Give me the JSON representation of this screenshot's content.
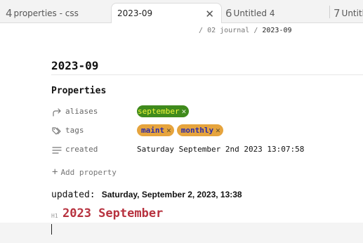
{
  "tabs": [
    {
      "num": "4",
      "label": "properties - css"
    },
    {
      "num": "",
      "label": "2023-09",
      "close": "✕"
    },
    {
      "num": "6",
      "label": "Untitled 4"
    },
    {
      "num": "7",
      "label": "Untitled"
    }
  ],
  "breadcrumb": {
    "sep1": "/",
    "folder": "02 journal",
    "sep2": "/",
    "current": "2023-09"
  },
  "note": {
    "title": "2023-09",
    "properties_heading": "Properties",
    "properties": [
      {
        "key": "aliases",
        "icon": "arrow-forward-icon",
        "values": [
          "september"
        ]
      },
      {
        "key": "tags",
        "icon": "tags-icon",
        "values": [
          "maint",
          "monthly"
        ]
      },
      {
        "key": "created",
        "icon": "text-lines-icon",
        "value": "Saturday September 2nd 2023 13:07:58"
      }
    ],
    "add_property": "Add property",
    "add_property_icon": "+",
    "updated_key": "updated:",
    "updated_value": "Saturday, September 2, 2023, 13:38",
    "h1_marker": "H1",
    "h1_text": "2023 September"
  },
  "colors": {
    "alias_pill": "#3f8a1c",
    "alias_text": "#f1f53a",
    "tag_pill": "#e6a43d",
    "tag_text": "#2b2aa8",
    "heading": "#b7323f"
  },
  "pill_remove_glyph": "✕"
}
